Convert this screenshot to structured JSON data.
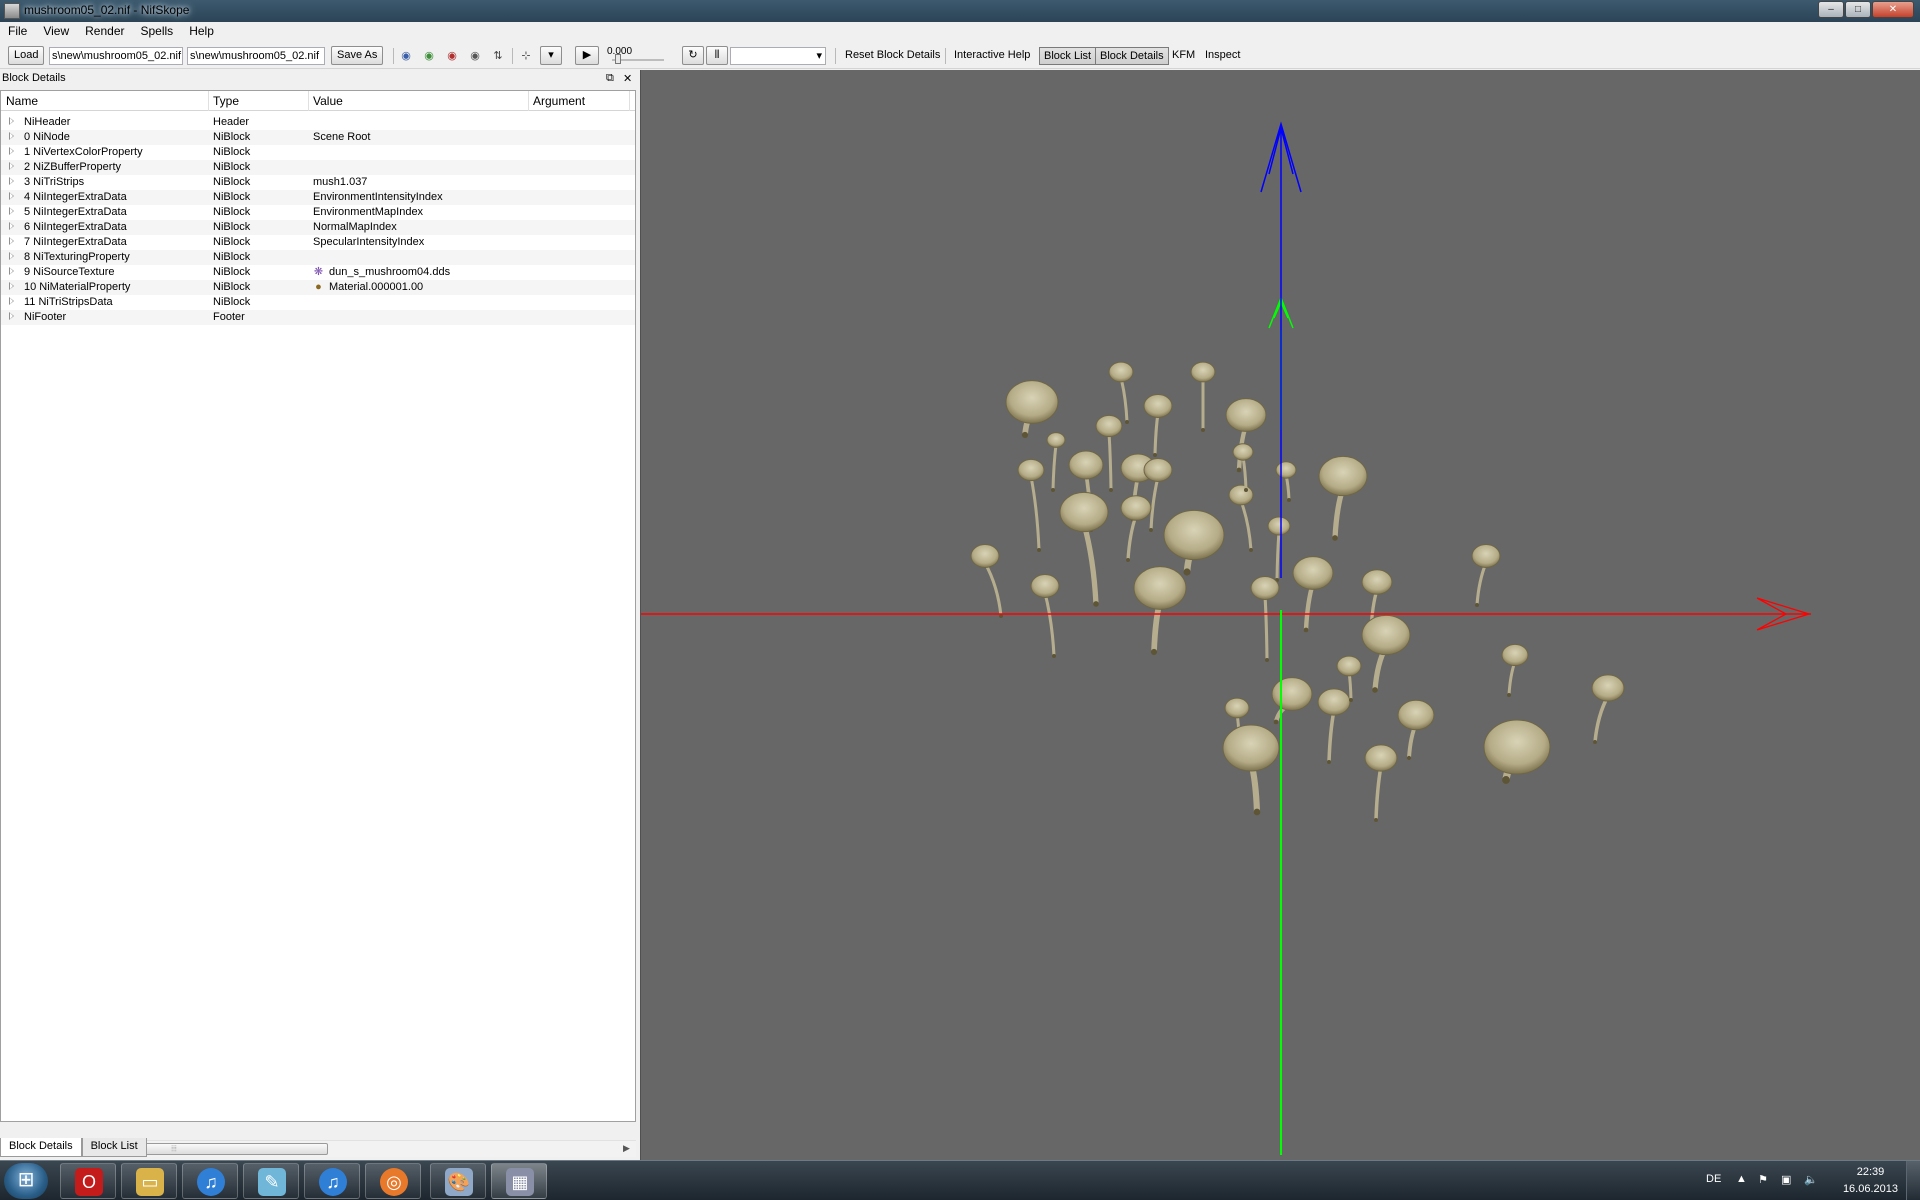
{
  "window": {
    "title": "mushroom05_02.nif - NifSkope",
    "minimize": "–",
    "maximize": "□",
    "close": "✕"
  },
  "menu": [
    "File",
    "View",
    "Render",
    "Spells",
    "Help"
  ],
  "toolbar": {
    "load_label": "Load",
    "load_path": "s\\new\\mushroom05_02.nif",
    "save_path": "s\\new\\mushroom05_02.nif",
    "save_as_label": "Save As",
    "time_value": "0.000",
    "reset_block_details": "Reset Block Details",
    "interactive_help": "Interactive Help",
    "block_list": "Block List",
    "block_details": "Block Details",
    "kfm": "KFM",
    "inspect": "Inspect",
    "eye_icon_colors": [
      "#3a5fa8",
      "#3f8f3a",
      "#b03030",
      "#555555"
    ]
  },
  "dock": {
    "title": "Block Details",
    "float_icon": "⧉",
    "close_icon": "✕",
    "columns": [
      "Name",
      "Type",
      "Value",
      "Argument"
    ],
    "rows": [
      {
        "name": "NiHeader",
        "type": "Header",
        "value": ""
      },
      {
        "name": "0 NiNode",
        "type": "NiBlock",
        "value": "Scene Root"
      },
      {
        "name": "1 NiVertexColorProperty",
        "type": "NiBlock",
        "value": ""
      },
      {
        "name": "2 NiZBufferProperty",
        "type": "NiBlock",
        "value": ""
      },
      {
        "name": "3 NiTriStrips",
        "type": "NiBlock",
        "value": "mush1.037"
      },
      {
        "name": "4 NiIntegerExtraData",
        "type": "NiBlock",
        "value": "EnvironmentIntensityIndex"
      },
      {
        "name": "5 NiIntegerExtraData",
        "type": "NiBlock",
        "value": "EnvironmentMapIndex"
      },
      {
        "name": "6 NiIntegerExtraData",
        "type": "NiBlock",
        "value": "NormalMapIndex"
      },
      {
        "name": "7 NiIntegerExtraData",
        "type": "NiBlock",
        "value": "SpecularIntensityIndex"
      },
      {
        "name": "8 NiTexturingProperty",
        "type": "NiBlock",
        "value": ""
      },
      {
        "name": "9 NiSourceTexture",
        "type": "NiBlock",
        "value": "dun_s_mushroom04.dds",
        "icon": "texture-icon"
      },
      {
        "name": "10 NiMaterialProperty",
        "type": "NiBlock",
        "value": "Material.000001.00",
        "icon": "material-icon"
      },
      {
        "name": "11 NiTriStripsData",
        "type": "NiBlock",
        "value": ""
      },
      {
        "name": "NiFooter",
        "type": "Footer",
        "value": ""
      }
    ],
    "tabs": [
      "Block Details",
      "Block List"
    ]
  },
  "viewport": {
    "background": "#676767",
    "axis_colors": {
      "x": "#ff0000",
      "y": "#00ff00",
      "z": "#0000ff"
    }
  },
  "taskbar": {
    "apps": [
      "opera",
      "explorer",
      "itunes",
      "notepad",
      "itunes",
      "blender",
      "paint",
      "nifskope"
    ],
    "language": "DE",
    "time": "22:39",
    "date": "16.06.2013"
  }
}
